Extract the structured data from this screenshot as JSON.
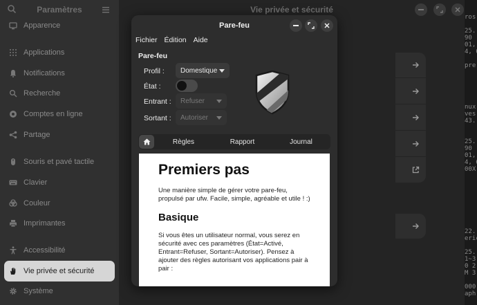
{
  "settings": {
    "sidebar_title": "Paramètres",
    "content_title": "Vie privée et sécurité",
    "items": [
      {
        "label": "Apparence",
        "icon": "display-icon"
      },
      {
        "label": "Applications",
        "icon": "apps-grid-icon"
      },
      {
        "label": "Notifications",
        "icon": "bell-icon"
      },
      {
        "label": "Recherche",
        "icon": "search-icon"
      },
      {
        "label": "Comptes en ligne",
        "icon": "online-accounts-icon"
      },
      {
        "label": "Partage",
        "icon": "share-icon"
      },
      {
        "label": "Souris et pavé tactile",
        "icon": "mouse-icon"
      },
      {
        "label": "Clavier",
        "icon": "keyboard-icon"
      },
      {
        "label": "Couleur",
        "icon": "color-icon"
      },
      {
        "label": "Imprimantes",
        "icon": "printer-icon"
      },
      {
        "label": "Accessibilité",
        "icon": "accessibility-icon"
      },
      {
        "label": "Vie privée et sécurité",
        "icon": "hand-icon"
      },
      {
        "label": "Système",
        "icon": "gear-icon"
      }
    ],
    "active_item": "Vie privée et sécurité"
  },
  "dialog": {
    "title": "Pare-feu",
    "menu": [
      "Fichier",
      "Édition",
      "Aide"
    ],
    "section_title": "Pare-feu",
    "profile_label": "Profil :",
    "profile_value": "Domestique",
    "state_label": "État :",
    "state_on": false,
    "incoming_label": "Entrant :",
    "incoming_value": "Refuser",
    "outgoing_label": "Sortant :",
    "outgoing_value": "Autoriser",
    "tabs": [
      "Règles",
      "Rapport",
      "Journal"
    ],
    "doc": {
      "h1": "Premiers pas",
      "p1": "Une manière simple de gérer votre pare-feu, propulsé par ufw. Facile, simple, agréable et utile ! :)",
      "h2": "Basique",
      "p2": "Si vous êtes un utilisateur normal, vous serez en sécurité avec ces paramètres (État=Activé, Entrant=Refuser, Sortant=Autoriser). Pensez à ajouter des règles autorisant vos applications pair à pair :"
    }
  },
  "strip_lines": [
    "ros",
    "",
    "25.",
    "90",
    "01,",
    "4, 6",
    "",
    "pre",
    "",
    "",
    "",
    "",
    "",
    "nux",
    "ves",
    "43.",
    "",
    "",
    "25.",
    "90",
    "01,",
    "4, 6",
    "00X",
    "",
    "",
    "",
    "",
    "",
    "",
    "",
    "",
    "22.",
    "eric",
    "",
    "25.",
    "1~3",
    "0 2",
    "M 3",
    "",
    "000",
    "aph"
  ]
}
